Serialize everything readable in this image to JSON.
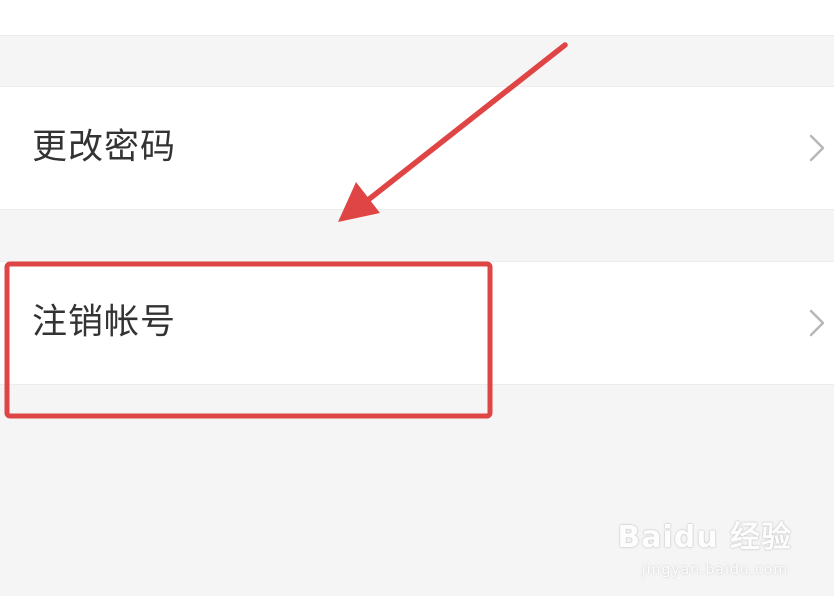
{
  "settings_list": {
    "items": [
      {
        "label": "更改密码",
        "icon": "chevron-right-icon"
      },
      {
        "label": "注销帐号",
        "icon": "chevron-right-icon"
      }
    ]
  },
  "annotation": {
    "highlight_color": "#e04545",
    "arrow_color": "#e04545"
  },
  "watermark": {
    "main": "Baidu 经验",
    "sub": "jingyan.baidu.com"
  },
  "colors": {
    "background": "#f5f5f5",
    "row_background": "#ffffff",
    "label_text": "#333333",
    "chevron": "#b8b8b8"
  }
}
